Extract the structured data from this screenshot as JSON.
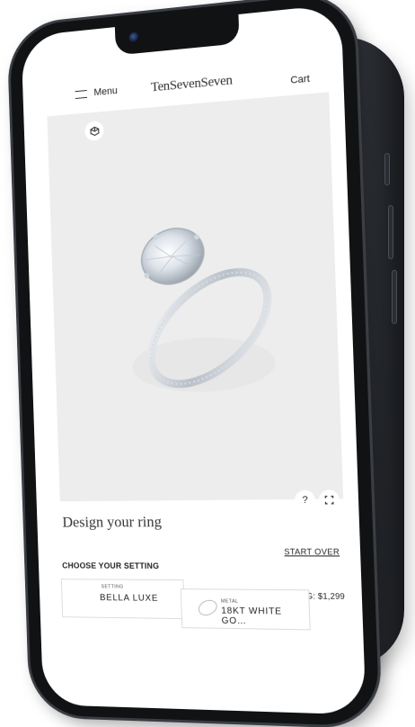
{
  "header": {
    "menu_label": "Menu",
    "brand": "TenSevenSeven",
    "cart_label": "Cart"
  },
  "gallery": {
    "image_subject": "oval diamond solitaire ring, white gold",
    "ar_icon": "cube-icon",
    "help_label": "?",
    "fullscreen_icon": "fullscreen-icon"
  },
  "builder": {
    "title": "Design your ring",
    "start_over_label": "START OVER",
    "choose_label": "CHOOSE YOUR SETTING",
    "setting_price": "SETTING: $1,299",
    "setting_card": {
      "label": "SETTING",
      "value": "BELLA LUXE"
    },
    "metal_card": {
      "label": "METAL",
      "value": "18KT WHITE GO…"
    }
  },
  "colors": {
    "device": "#111214",
    "gallery_bg": "#ededed",
    "text": "#222222"
  }
}
